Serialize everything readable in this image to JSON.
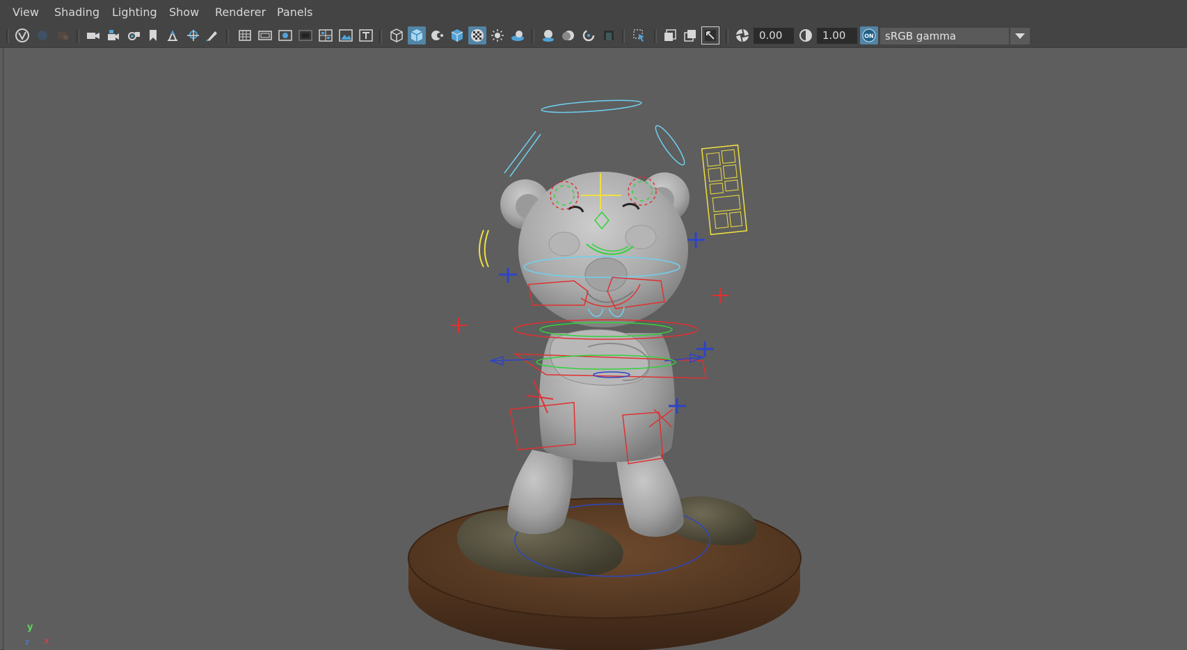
{
  "menubar": {
    "items": [
      {
        "label": "View"
      },
      {
        "label": "Shading"
      },
      {
        "label": "Lighting"
      },
      {
        "label": "Show"
      },
      {
        "label": "Renderer"
      },
      {
        "label": "Panels"
      }
    ]
  },
  "toolbar": {
    "icons": [
      "select-camera-icon",
      "lock-camera-icon",
      "camera-attributes-icon",
      "bookmark-icon",
      "image-plane-icon",
      "2d-pan-zoom-icon",
      "grease-pencil-icon",
      "grid-icon",
      "film-gate-icon",
      "resolution-gate-icon",
      "gate-mask-icon",
      "field-chart-icon",
      "safe-action-icon",
      "safe-title-icon",
      "wireframe-icon",
      "smooth-shade-icon",
      "default-material-icon",
      "wireframe-on-shaded-icon",
      "textured-icon",
      "use-all-lights-icon",
      "shadows-icon",
      "screen-space-ao-icon",
      "motion-blur-icon",
      "anti-aliasing-icon",
      "depth-of-field-icon",
      "isolate-select-icon",
      "xray-icon",
      "xray-joints-icon",
      "xray-components-icon",
      "exposure-icon",
      "gamma-icon",
      "color-management-toggle-icon"
    ],
    "exposure_value": "0.00",
    "gamma_value": "1.00",
    "color_management_badge": "ON",
    "color_space": "sRGB gamma"
  },
  "viewport": {
    "axis_labels": {
      "y": "y",
      "x": "x",
      "z": "z"
    }
  }
}
